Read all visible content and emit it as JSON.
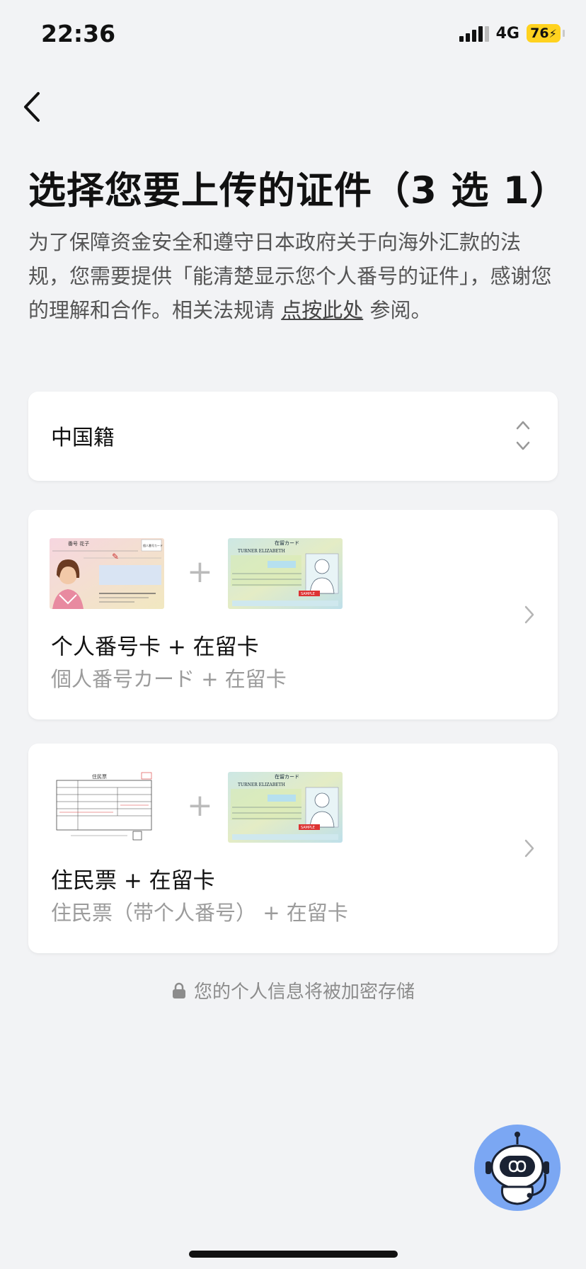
{
  "status": {
    "time": "22:36",
    "network": "4G",
    "battery": "76"
  },
  "header": {
    "title": "选择您要上传的证件（3 选 1）",
    "description_prefix": "为了保障资金安全和遵守日本政府关于向海外汇款的法规，您需要提供「能清楚显示您个人番号的证件」，感谢您的理解和合作。相关法规请 ",
    "link_text": "点按此处",
    "description_suffix": " 参阅。"
  },
  "nationality": {
    "value": "中国籍"
  },
  "options": [
    {
      "title": "个人番号卡 + 在留卡",
      "subtitle": "個人番号カード + 在留卡",
      "card_a": {
        "header": "番号 花子",
        "badge": "個人番号カード"
      },
      "card_b": {
        "header": "在留カード",
        "name": "TURNER ELIZABETH",
        "stamp": "SAMPLE"
      }
    },
    {
      "title": "住民票 + 在留卡",
      "subtitle": "住民票（带个人番号） + 在留卡",
      "card_a": {
        "header": "住民票"
      },
      "card_b": {
        "header": "在留カード",
        "name": "TURNER ELIZABETH",
        "stamp": "SAMPLE"
      }
    }
  ],
  "footer": {
    "secure_note": "您的个人信息将被加密存储"
  },
  "colors": {
    "background": "#f2f3f5",
    "battery": "#ffd21f",
    "assistant": "#7ba7f3"
  }
}
